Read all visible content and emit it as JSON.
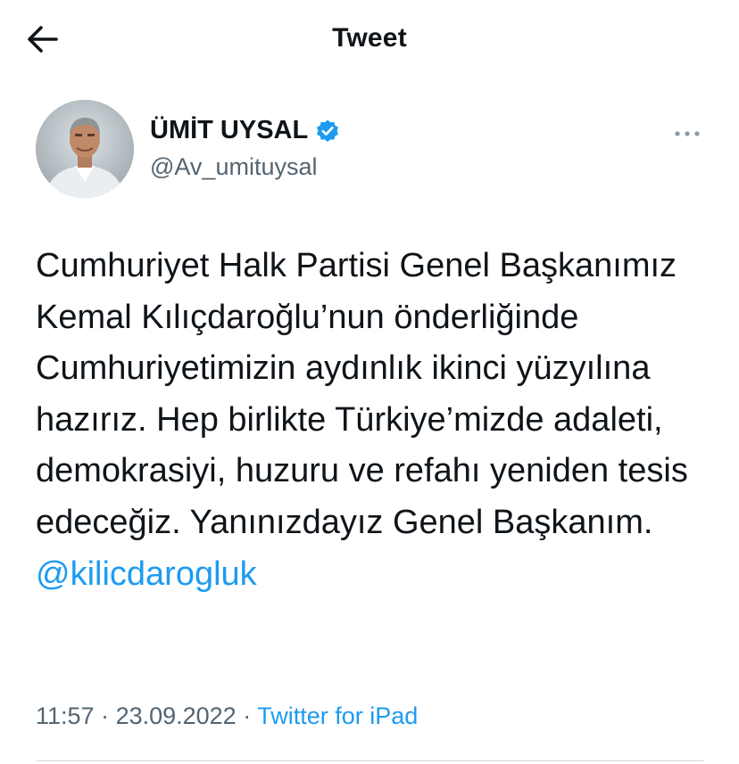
{
  "header": {
    "title": "Tweet",
    "back_icon": "arrow-left-icon"
  },
  "author": {
    "display_name": "ÜMİT UYSAL",
    "handle": "@Av_umituysal",
    "verified": true,
    "verified_icon": "verified-badge-icon",
    "more_icon": "more-horizontal-icon"
  },
  "tweet": {
    "text": "Cumhuriyet Halk Partisi Genel Başkanımız Kemal Kılıçdaroğlu’nun önderliğinde Cumhuriyetimizin aydınlık ikinci yüzyılına hazırız. Hep birlikte Türkiye’mizde adaleti, demokrasiyi, huzuru ve refahı yeniden tesis edeceğiz. Yanınızdayız Genel Başkanım. ",
    "mention": "@kilicdarogluk"
  },
  "meta": {
    "time": "11:57",
    "date": "23.09.2022",
    "separator": " · ",
    "source": "Twitter for iPad"
  },
  "colors": {
    "accent": "#1d9bf0",
    "text_primary": "#0f1419",
    "text_secondary": "#536471",
    "divider": "#cfd9de"
  }
}
